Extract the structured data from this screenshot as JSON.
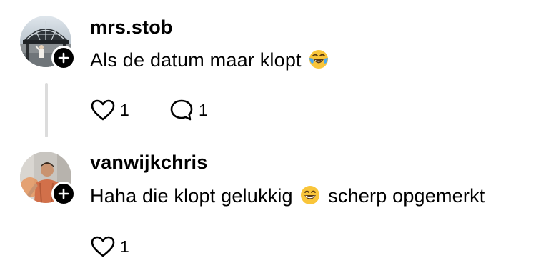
{
  "comments": [
    {
      "username": "mrs.stob",
      "text": "Als de datum maar klopt",
      "emoji": "face-with-tears-of-joy-emoji",
      "likes": "1",
      "replies": "1"
    },
    {
      "username": "vanwijkchris",
      "text_before": "Haha die klopt gelukkig",
      "emoji": "grinning-face-emoji",
      "text_after": "scherp opgemerkt",
      "likes": "1"
    }
  ],
  "icons": {
    "like": "heart-icon",
    "reply": "speech-bubble-icon",
    "follow": "plus-icon"
  },
  "colors": {
    "text": "#000000",
    "thread_line": "#dcdcdc",
    "badge": "#000000",
    "emoji_face": "#f9c53a"
  }
}
